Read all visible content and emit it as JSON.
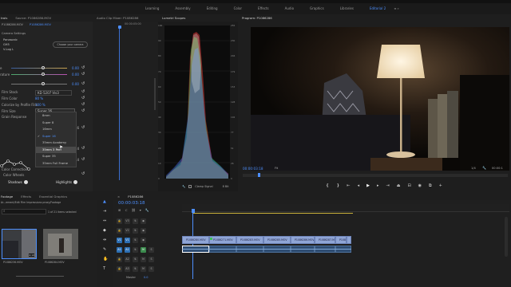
{
  "workspaces": [
    "Learning",
    "Assembly",
    "Editing",
    "Color",
    "Effects",
    "Audio",
    "Graphics",
    "Libraries",
    "Editorial 2"
  ],
  "workspace_active": "Editorial 2",
  "effect_controls": {
    "tabs": [
      "trols",
      "Source: P1086286.MOV",
      "Audio Clip Mixer: P1086286"
    ],
    "header_left": "P1086286.MOV",
    "header_right": "P1086286.MOV",
    "time_left": "00:00",
    "time_right": "00:00:05:00",
    "section": "Camera Settings",
    "camera_items": [
      "Panasonic",
      "GH5",
      "V-Log L"
    ],
    "choose_btn": "Choose your camera",
    "sliders": [
      {
        "label": "e",
        "value": "0.00"
      },
      {
        "label": "rature",
        "value": "0.00"
      },
      {
        "label": "",
        "value": "0.00"
      }
    ],
    "fields": [
      {
        "label": "Film Stock",
        "value": "KD 5207 Vis3"
      },
      {
        "label": "Film Color",
        "value": "80 %"
      },
      {
        "label": "Colorize by Profile Film",
        "value": "100 %"
      },
      {
        "label": "Film Size",
        "value": "Super 16"
      }
    ],
    "grain_label": "Grain Response",
    "film_size_options": [
      "8mm",
      "Super 8",
      "16mm",
      "Super 16",
      "35mm Academy",
      "35mm 3 Perf",
      "Super 35",
      "35mm Full Frame"
    ],
    "film_size_selected": "Super 16",
    "film_size_hover": "35mm 3 Perf",
    "right_values": [
      "16",
      "24",
      "14"
    ],
    "color_correction": "Color Correction",
    "color_wheels": "Color Wheels",
    "shadows": "Shadows",
    "highlights": "Highlights"
  },
  "scopes": {
    "tab": "Lumetri Scopes",
    "clamp": "Clamp Signal",
    "bit": "8 Bit",
    "scale": [
      "100",
      "90",
      "80",
      "70",
      "60",
      "50",
      "40",
      "30",
      "20",
      "10",
      "0"
    ],
    "scale_right": [
      "255",
      "230",
      "204",
      "179",
      "153",
      "128",
      "102",
      "77",
      "51",
      "26",
      "0"
    ]
  },
  "program": {
    "tab": "Program: P1086286",
    "timecode": "00:00:03:18",
    "fit": "Fit",
    "fraction": "1/4",
    "end_time": "00:00:1"
  },
  "project": {
    "tabs": [
      "Footage",
      "Effects",
      "Essential Graphics"
    ],
    "path": "Ar...ement/Edit Film Impressions proxy/Footage",
    "count": "1 of 21 items selected",
    "thumbs": [
      {
        "name": "P1086236.MOV",
        "duration": "4:10"
      },
      {
        "name": "P1086284.MOV",
        "duration": ""
      }
    ]
  },
  "timeline": {
    "tab": "P1086286",
    "timecode": "00:00:03:18",
    "tracks": [
      "V3",
      "V2",
      "V1",
      "A1",
      "A2",
      "A3"
    ],
    "master": "Master",
    "master_value": "0.0",
    "clips": [
      "P1086280.MOV",
      "P1086271.MOV",
      "P1086283.MOV",
      "P1086285.MOV",
      "P1086286.MOV",
      "P1086287.MOV",
      "P1086289.MOV",
      "P1086290.MOV"
    ]
  }
}
